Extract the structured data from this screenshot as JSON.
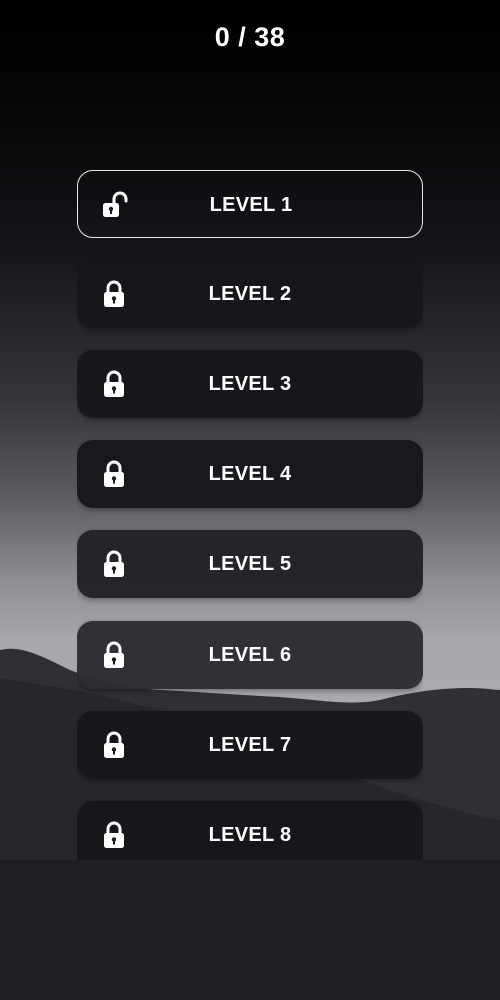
{
  "header": {
    "progress_text": "0 / 38"
  },
  "levels": [
    {
      "label": "LEVEL 1",
      "icon": "unlocked-padlock-icon",
      "state": "unlocked"
    },
    {
      "label": "LEVEL 2",
      "icon": "padlock-icon",
      "state": "locked"
    },
    {
      "label": "LEVEL 3",
      "icon": "padlock-icon",
      "state": "locked"
    },
    {
      "label": "LEVEL 4",
      "icon": "padlock-icon",
      "state": "locked"
    },
    {
      "label": "LEVEL 5",
      "icon": "padlock-icon",
      "state": "locked"
    },
    {
      "label": "LEVEL 6",
      "icon": "padlock-icon",
      "state": "locked"
    },
    {
      "label": "LEVEL 7",
      "icon": "padlock-icon",
      "state": "locked"
    },
    {
      "label": "LEVEL 8",
      "icon": "padlock-icon",
      "state": "locked"
    }
  ],
  "colors": {
    "text": "#ffffff",
    "button_background": "#16171b",
    "selected_border": "#e9e9ea"
  }
}
